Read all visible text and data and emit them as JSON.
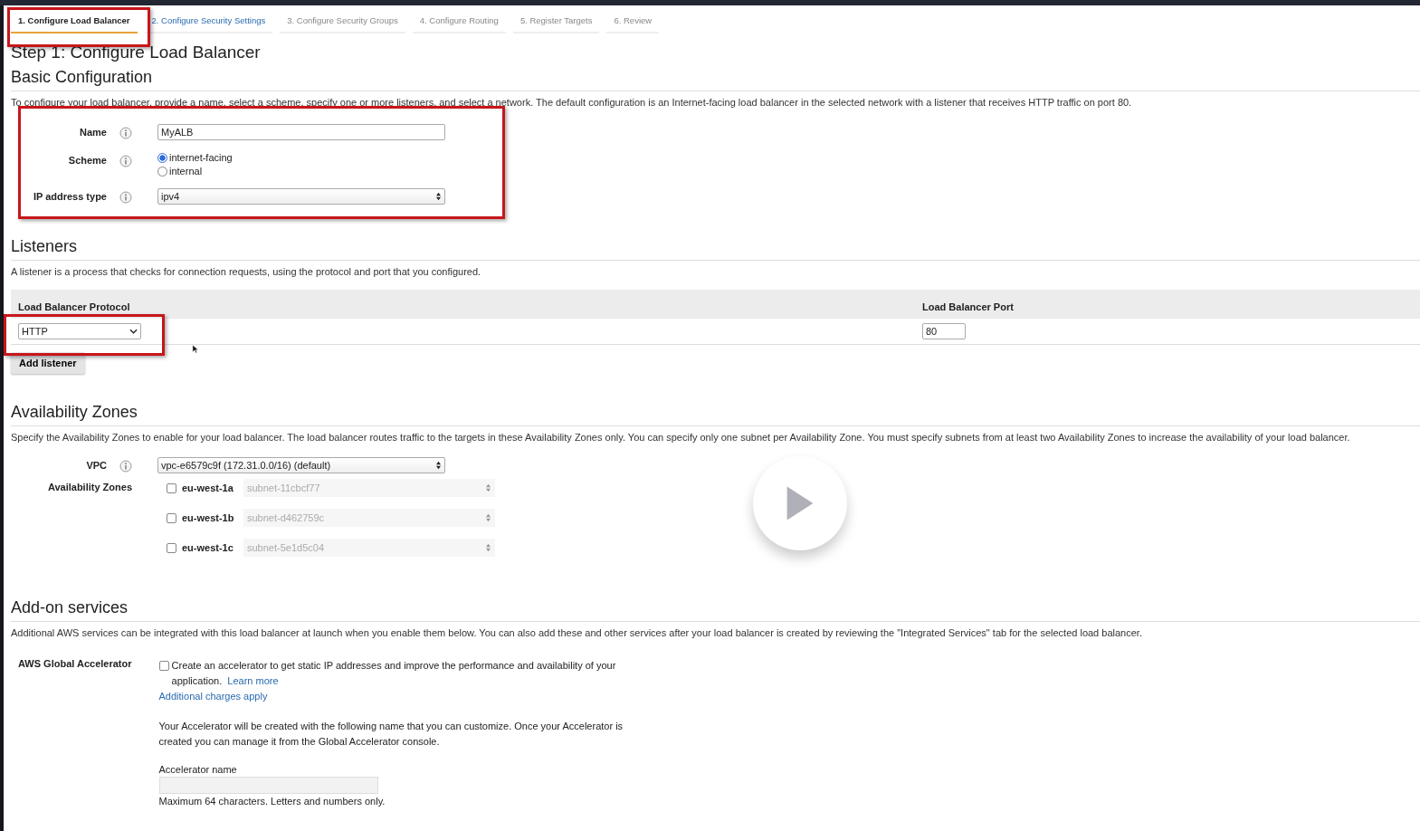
{
  "wizard_tabs": [
    {
      "label": "1. Configure Load Balancer",
      "selected": true,
      "disabled": false
    },
    {
      "label": "2. Configure Security Settings",
      "selected": false,
      "disabled": false
    },
    {
      "label": "3. Configure Security Groups",
      "selected": false,
      "disabled": true
    },
    {
      "label": "4. Configure Routing",
      "selected": false,
      "disabled": true
    },
    {
      "label": "5. Register Targets",
      "selected": false,
      "disabled": true
    },
    {
      "label": "6. Review",
      "selected": false,
      "disabled": true
    }
  ],
  "title": "Step 1: Configure Load Balancer",
  "basic_configuration": {
    "heading": "Basic Configuration",
    "description": "To configure your load balancer, provide a name, select a scheme, specify one or more listeners, and select a network. The default configuration is an Internet-facing load balancer in the selected network with a listener that receives HTTP traffic on port 80.",
    "fields": [
      {
        "kind": "text",
        "label": "Name",
        "value": "MyALB"
      },
      {
        "kind": "radio",
        "label": "Scheme",
        "options": [
          {
            "label": "internet-facing",
            "selected": true
          },
          {
            "label": "internal",
            "selected": false
          }
        ]
      },
      {
        "kind": "select",
        "label": "IP address type",
        "value": "ipv4"
      }
    ]
  },
  "listeners": {
    "heading": "Listeners",
    "description": "A listener is a process that checks for connection requests, using the protocol and port that you configured.",
    "columns": [
      "Load Balancer Protocol",
      "Load Balancer Port"
    ],
    "rows": [
      {
        "protocol": "HTTP",
        "port": "80"
      }
    ],
    "add_button": "Add listener"
  },
  "availability_zones": {
    "heading": "Availability Zones",
    "description": "Specify the Availability Zones to enable for your load balancer. The load balancer routes traffic to the targets in these Availability Zones only. You can specify only one subnet per Availability Zone. You must specify subnets from at least two Availability Zones to increase the availability of your load balancer.",
    "vpc_label": "VPC",
    "vpc_value": "vpc-e6579c9f (172.31.0.0/16) (default)",
    "zones_label": "Availability Zones",
    "zones": [
      {
        "name": "eu-west-1a",
        "checked": false,
        "subnet": "subnet-11cbcf77"
      },
      {
        "name": "eu-west-1b",
        "checked": false,
        "subnet": "subnet-d462759c"
      },
      {
        "name": "eu-west-1c",
        "checked": false,
        "subnet": "subnet-5e1d5c04"
      }
    ]
  },
  "addon_services": {
    "heading": "Add-on services",
    "description": "Additional AWS services can be integrated with this load balancer at launch when you enable them below. You can also add these and other services after your load balancer is created by reviewing the \"Integrated Services\" tab for the selected load balancer.",
    "accelerator": {
      "label": "AWS Global Accelerator",
      "checked": false,
      "checkbox_text": "Create an accelerator to get static IP addresses and improve the performance and availability of your application.",
      "learn_more": "Learn more",
      "charges_link": "Additional charges apply",
      "note": "Your Accelerator will be created with the following name that you can customize. Once your Accelerator is created you can manage it from the Global Accelerator console.",
      "name_label": "Accelerator name",
      "name_hint": "Maximum 64 characters. Letters and numbers only."
    }
  }
}
